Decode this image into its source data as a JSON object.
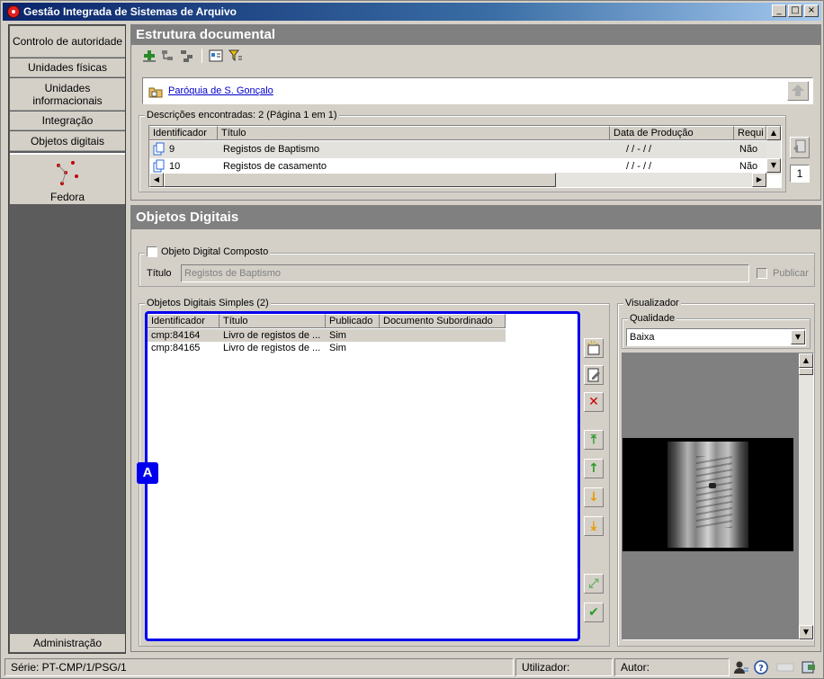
{
  "window": {
    "title": "Gestão Integrada de Sistemas de Arquivo",
    "buttons": [
      "_",
      "□",
      "×"
    ]
  },
  "sidebar": {
    "items": [
      {
        "label": "Controlo de autoridade"
      },
      {
        "label": "Unidades físicas"
      },
      {
        "label": "Unidades informacionais"
      },
      {
        "label": "Integração"
      },
      {
        "label": "Objetos digitais"
      }
    ],
    "active": {
      "label": "Fedora",
      "icon": "fedora-icon"
    },
    "bottom": {
      "label": "Administração"
    }
  },
  "estrutura": {
    "title": "Estrutura documental",
    "toolbar_icons": [
      "add-icon",
      "tree-icon",
      "tree-multi-icon",
      "report-icon",
      "filter-icon"
    ],
    "breadcrumb": "Paróquia de S. Gonçalo",
    "group_label": "Descrições encontradas: 2 (Página 1 em 1)",
    "columns": [
      "Identificador",
      "Título",
      "Data de Produção",
      "Requi"
    ],
    "rows": [
      {
        "id": "9",
        "titulo": "Registos de Baptismo",
        "data": "/ /  -  / /",
        "requi": "Não"
      },
      {
        "id": "10",
        "titulo": "Registos de casamento",
        "data": "/ /  -  / /",
        "requi": "Não"
      }
    ],
    "page_number": "1"
  },
  "objetos": {
    "title": "Objetos Digitais",
    "composto_label": "Objeto Digital Composto",
    "titulo_label": "Título",
    "titulo_value": "Registos de Baptismo",
    "publicar_label": "Publicar",
    "simples_label": "Objetos Digitais Simples (2)",
    "columns": [
      "Identificador",
      "Título",
      "Publicado",
      "Documento Subordinado"
    ],
    "rows": [
      {
        "id": "cmp:84164",
        "titulo": "Livro de registos de ...",
        "publicado": "Sim",
        "subordinado": ""
      },
      {
        "id": "cmp:84165",
        "titulo": "Livro de registos de ...",
        "publicado": "Sim",
        "subordinado": ""
      }
    ],
    "badge": "A"
  },
  "visualizador": {
    "label": "Visualizador",
    "qualidade_label": "Qualidade",
    "qualidade_value": "Baixa"
  },
  "status": {
    "serie": "Série: PT-CMP/1/PSG/1",
    "utilizador": "Utilizador:",
    "autor": "Autor:"
  },
  "colors": {
    "highlight": "#0000ee",
    "panel_header": "#808080",
    "sidebar_bg": "#5c5c5c"
  }
}
